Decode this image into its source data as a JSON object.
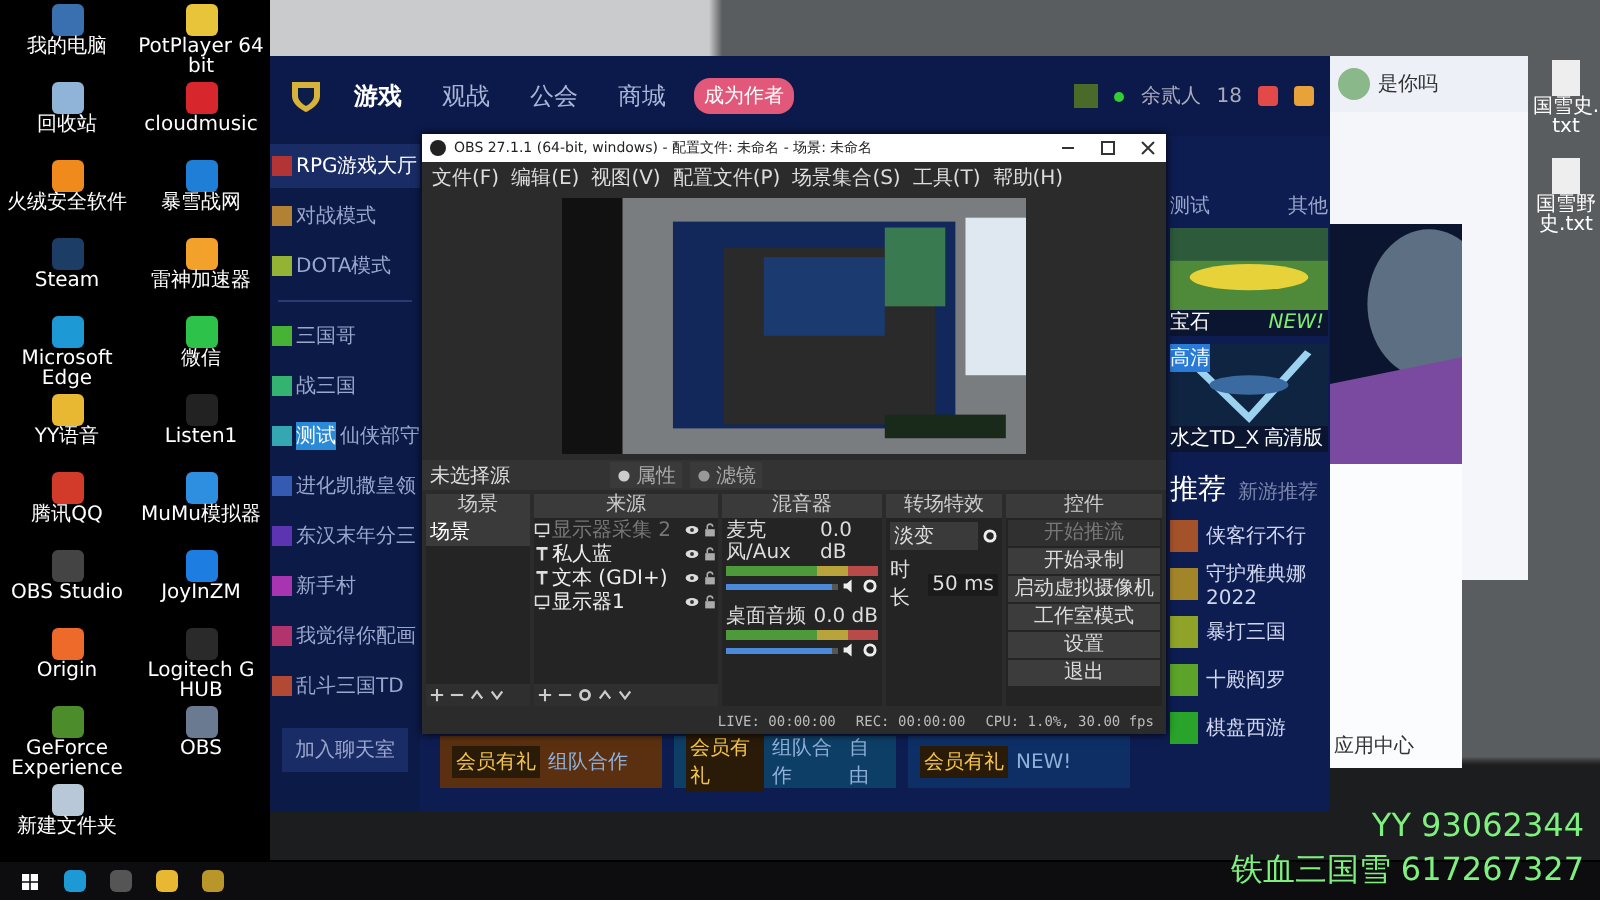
{
  "desktop_icons": [
    {
      "label": "我的电脑",
      "color": "#3a6fb0"
    },
    {
      "label": "PotPlayer 64 bit",
      "color": "#e8c43a"
    },
    {
      "label": "回收站",
      "color": "#8fb4d8"
    },
    {
      "label": "cloudmusic",
      "color": "#d8262d"
    },
    {
      "label": "火绒安全软件",
      "color": "#f08a1c"
    },
    {
      "label": "暴雪战网",
      "color": "#1f7fd6"
    },
    {
      "label": "Steam",
      "color": "#1b3d66"
    },
    {
      "label": "雷神加速器",
      "color": "#f2a22a"
    },
    {
      "label": "Microsoft Edge",
      "color": "#1d9ad6"
    },
    {
      "label": "微信",
      "color": "#2dc24a"
    },
    {
      "label": "YY语音",
      "color": "#e9b833"
    },
    {
      "label": "Listen1",
      "color": "#222222"
    },
    {
      "label": "腾讯QQ",
      "color": "#d23a2a"
    },
    {
      "label": "MuMu模拟器",
      "color": "#2e8fe0"
    },
    {
      "label": "OBS Studio",
      "color": "#444444"
    },
    {
      "label": "JoyInZM",
      "color": "#1e7de0"
    },
    {
      "label": "Origin",
      "color": "#ee6a2a"
    },
    {
      "label": "Logitech G HUB",
      "color": "#2a2a2a"
    },
    {
      "label": "GeForce Experience",
      "color": "#4c8c2a"
    },
    {
      "label": "OBS",
      "color": "#6a7a90"
    },
    {
      "label": "新建文件夹",
      "color": "#b8c8d8"
    }
  ],
  "game_client": {
    "nav": [
      {
        "label": "游戏",
        "selected": true
      },
      {
        "label": "观战",
        "selected": false
      },
      {
        "label": "公会",
        "selected": false
      },
      {
        "label": "商城",
        "selected": false
      }
    ],
    "author_badge": "成为作者",
    "user": "余贰人",
    "count": "18",
    "sidebar": [
      {
        "label": "RPG游戏大厅",
        "selected": true
      },
      {
        "label": "对战模式",
        "selected": false
      },
      {
        "label": "DOTA模式",
        "selected": false
      },
      {
        "label": "三国哥",
        "selected": false
      },
      {
        "label": "战三国",
        "selected": false
      },
      {
        "label": "仙侠部守",
        "tag": "测试",
        "selected": false
      },
      {
        "label": "进化凯撒皇领",
        "selected": false
      },
      {
        "label": "东汉末年分三",
        "selected": false
      },
      {
        "label": "新手村",
        "selected": false
      },
      {
        "label": "我觉得你配画",
        "selected": false
      },
      {
        "label": "乱斗三国TD",
        "selected": false
      }
    ],
    "chat_button": "加入聊天室",
    "tabs": [
      "测试",
      "其他"
    ],
    "featured": [
      {
        "caption": "宝石",
        "badge": "NEW!"
      },
      {
        "caption": "水之TD_X 高清版",
        "badge": "高清"
      }
    ],
    "recommend_title": "推荐",
    "recommend_sub": "新游推荐",
    "recommend": [
      "侠客行不行",
      "守护雅典娜2022",
      "暴打三国",
      "十殿阎罗",
      "棋盘西游"
    ],
    "promos": [
      {
        "tag": "会员有礼",
        "labels": [
          "组队合作"
        ],
        "color": "#5a3010"
      },
      {
        "tag": "会员有礼",
        "labels": [
          "组队合作",
          "自由"
        ],
        "color": "#0d3e66"
      },
      {
        "tag": "会员有礼",
        "labels": [
          "NEW!"
        ],
        "color": "#0e2f66"
      }
    ]
  },
  "obs": {
    "title": "OBS 27.1.1 (64-bit, windows) - 配置文件: 未命名 - 场景: 未命名",
    "menu": [
      "文件(F)",
      "编辑(E)",
      "视图(V)",
      "配置文件(P)",
      "场景集合(S)",
      "工具(T)",
      "帮助(H)"
    ],
    "no_source": "未选择源",
    "properties": "属性",
    "filters": "滤镜",
    "docks": [
      "场景",
      "来源",
      "混音器",
      "转场特效",
      "控件"
    ],
    "scenes": [
      {
        "label": "场景",
        "selected": true
      }
    ],
    "sources": [
      {
        "label": "显示器采集 2",
        "kind": "display",
        "disabled": true
      },
      {
        "label": "私人蓝",
        "kind": "text",
        "disabled": false
      },
      {
        "label": "文本 (GDI+)",
        "kind": "text",
        "disabled": false
      },
      {
        "label": "显示器1",
        "kind": "display",
        "disabled": false
      }
    ],
    "mixer": [
      {
        "name": "麦克风/Aux",
        "reading": "0.0 dB",
        "level": 0.95
      },
      {
        "name": "桌面音频",
        "reading": "0.0 dB",
        "level": 0.95
      }
    ],
    "transition": "淡变",
    "duration_label": "时长",
    "duration": "50 ms",
    "controls": [
      {
        "label": "开始推流",
        "disabled": true
      },
      {
        "label": "开始录制",
        "disabled": false
      },
      {
        "label": "启动虚拟摄像机",
        "disabled": false
      },
      {
        "label": "工作室模式",
        "disabled": false
      },
      {
        "label": "设置",
        "disabled": false
      },
      {
        "label": "退出",
        "disabled": false
      }
    ],
    "status": [
      "LIVE: 00:00:00",
      "REC: 00:00:00",
      "CPU: 1.0%, 30.00 fps"
    ]
  },
  "qq": {
    "name": "是你吗",
    "footer": "应用中心"
  },
  "desktop_files": [
    "国雪史.txt",
    "国雪野史.txt"
  ],
  "overlay": [
    "YY 93062344",
    "铁血三国雪 617267327"
  ]
}
